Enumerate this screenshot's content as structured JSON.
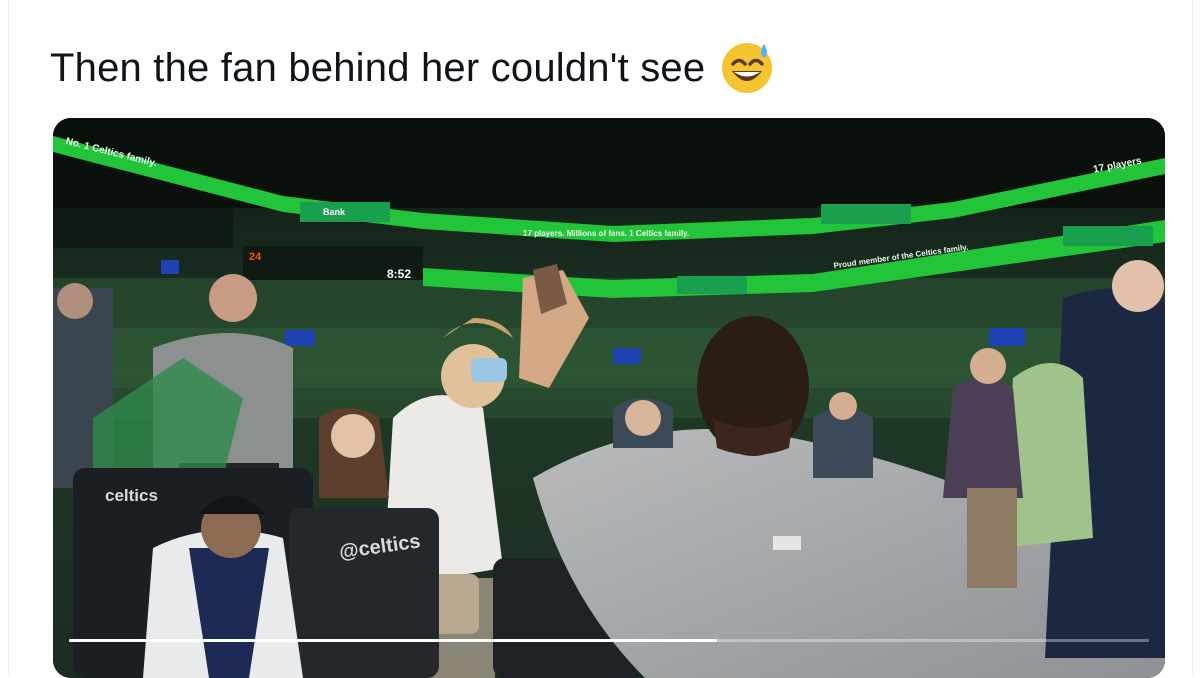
{
  "tweet": {
    "text": "Then the fan behind her couldn't see",
    "emoji_icon": "grinning-sweat-emoji"
  },
  "video": {
    "ribbon_upper_left": "No. 1 Celtics family.",
    "ribbon_upper_right": "17 players",
    "ribbon_middle": "17 players. Millions of fans. 1 Celtics family.",
    "ribbon_lower": "Proud member of the Celtics family.",
    "sponsor": "Bank",
    "shot_clock_home": "24",
    "game_clock": "8:52",
    "courtside_logo": "celtics",
    "seat_logo": "@celtics",
    "progress": 0.6
  },
  "colors": {
    "ribbon_green": "#22c43a",
    "sponsor_green": "#1a9f4e",
    "tweet_text": "#0f1419"
  }
}
